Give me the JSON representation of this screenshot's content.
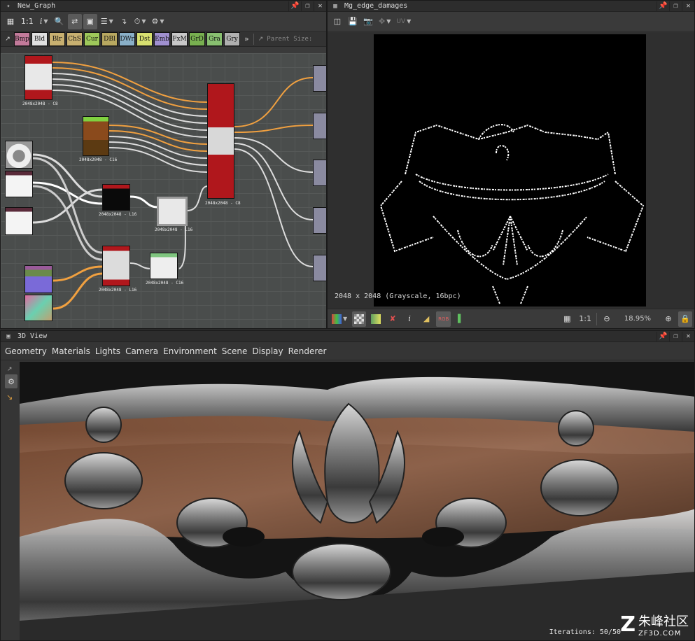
{
  "graph_panel": {
    "title": "New_Graph",
    "toolbar": {
      "zoom_label": "1:1",
      "info_label": "i"
    },
    "library": [
      "Bmp",
      "Bld",
      "Blr",
      "ChS",
      "Cur",
      "DBl",
      "DWr",
      "Dst",
      "Emb",
      "FxM",
      "GrD",
      "Gra",
      "Gry"
    ],
    "library_colors": [
      "#c27a9a",
      "#e0e0e0",
      "#c8b070",
      "#c8b070",
      "#9ec85a",
      "#b8a860",
      "#8ab0c8",
      "#d8e070",
      "#a090d0",
      "#c8c8c8",
      "#78b050",
      "#88c070",
      "#b0b0b0"
    ],
    "more_label": "»",
    "parent_size_label": "Parent Size:",
    "node_labels": {
      "n1": "2048x2048 - C8",
      "n2": "2048x2048 - C16",
      "n3": "2048x2048 - L16",
      "n4": "2048x2048 - C8",
      "n5": "2048x2048 - L16",
      "n6": "2048x2048 - L16",
      "n7": "2048x2048 - C16"
    }
  },
  "viewer_panel": {
    "title": "Mg_edge_damages",
    "uv_label": "UV",
    "image_info": "2048 x 2048 (Grayscale, 16bpc)",
    "zoom_ratio": "1:1",
    "zoom_percent": "18.95%",
    "rgb_label": "RGB"
  },
  "view3d_panel": {
    "title": "3D View",
    "menu": [
      "Geometry",
      "Materials",
      "Lights",
      "Camera",
      "Environment",
      "Scene",
      "Display",
      "Renderer"
    ],
    "iterations": "Iterations: 50/50",
    "watermark_cn": "朱峰社区",
    "watermark_url": "ZF3D.COM"
  },
  "colors": {
    "accent_orange": "#f0a040",
    "panel_bg": "#3a3a3a",
    "title_bg": "#2d2d2d",
    "node_red": "#b0171c",
    "node_green": "#7fd140"
  }
}
